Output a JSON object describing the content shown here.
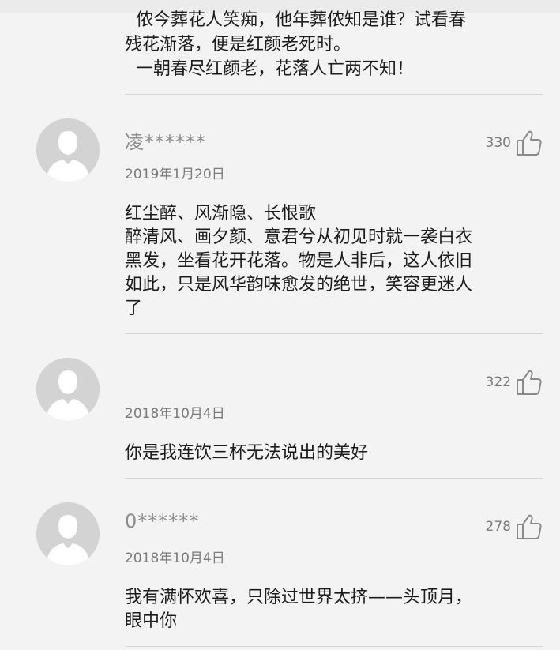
{
  "top_comment": {
    "lines": [
      "  侬今葬花人笑痴，他年葬侬知是谁？试看春",
      "残花渐落，便是红颜老死时。",
      "  一朝春尽红颜老，花落人亡两不知！"
    ]
  },
  "comments": [
    {
      "username": "凌******",
      "date": "2019年1月20日",
      "likes": "330",
      "body_lines": [
        "红尘醉、风渐隐、长恨歌",
        "醉清风、画夕颜、意君兮从初见时就一袭白衣",
        "黑发，坐看花开花落。物是人非后，这人依旧",
        "如此，只是风华韵味愈发的绝世，笑容更迷人",
        "了"
      ]
    },
    {
      "username": "",
      "date": "2018年10月4日",
      "likes": "322",
      "body_lines": [
        "你是我连饮三杯无法说出的美好"
      ]
    },
    {
      "username": "0******",
      "date": "2018年10月4日",
      "likes": "278",
      "body_lines": [
        "我有满怀欢喜，只除过世界太挤——头顶月，",
        "眼中你"
      ]
    }
  ],
  "icons": {
    "avatar": "default-user-avatar-icon",
    "like": "thumbs-up-icon"
  },
  "colors": {
    "background": "#f3f3f3",
    "avatar": "#d3d3d3",
    "muted_text": "#7a7a7a"
  }
}
